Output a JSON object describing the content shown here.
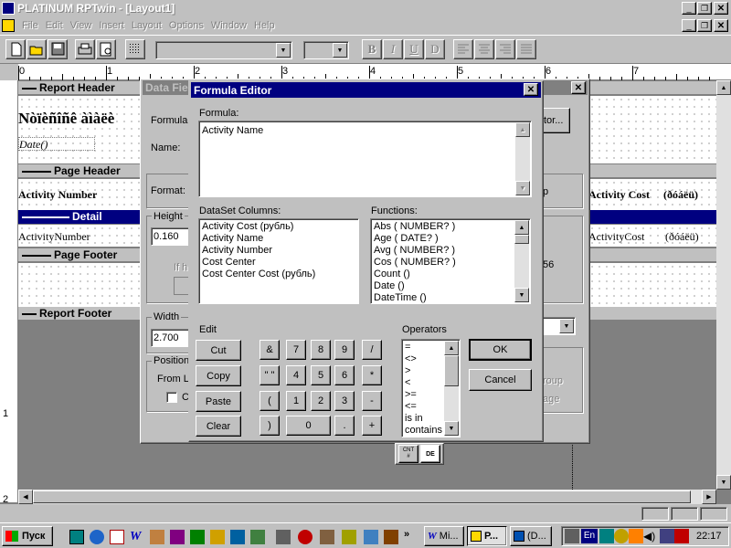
{
  "app": {
    "title": "PLATINUM RPTwin - [Layout1]",
    "menu": [
      "File",
      "Edit",
      "View",
      "Insert",
      "Layout",
      "Options",
      "Window",
      "Help"
    ]
  },
  "toolbar": {
    "format_buttons": [
      "B",
      "I",
      "U",
      "D"
    ]
  },
  "ruler": {
    "marks": [
      "0",
      "1",
      "2",
      "3",
      "4",
      "5",
      "6",
      "7"
    ]
  },
  "report": {
    "bands": {
      "report_header": "Report Header",
      "page_header": "Page Header",
      "detail": "Detail",
      "page_footer": "Page Footer",
      "report_footer": "Report Footer"
    },
    "title_text": "Nòïèñîñê àìàëè",
    "date_field": "Date()",
    "activity_number_header": "Activity Number",
    "activity_number_field": "ActivityNumber",
    "activity_cost_header": "Activity Cost",
    "activity_cost_suffix": "(ðóáëü)",
    "activity_cost_field": "ActivityCost",
    "activity_cost_field_suffix": "(ðóáëü)"
  },
  "data_field_dialog": {
    "title": "Data Fie",
    "formula_label": "Formula:",
    "name_label": "Name:",
    "format_label": "Format:",
    "height_label": "Height",
    "height_value": "0.160",
    "width_label": "Width",
    "width_value": "2.700",
    "position_label": "Position",
    "from_label": "From Le",
    "checkbox_label": "C",
    "if_label": "If h",
    "right_btn_label": "tor...",
    "right_p": "p",
    "right_56": "56",
    "right_group": "roup",
    "right_age": "age"
  },
  "formula_editor": {
    "title": "Formula Editor",
    "formula_label": "Formula:",
    "formula_value": "Activity Name",
    "dataset_label": "DataSet Columns:",
    "dataset_columns": [
      "Activity Cost    (рубль)",
      "Activity Name",
      "Activity Number",
      "Cost Center",
      "Cost Center Cost (рубль)"
    ],
    "functions_label": "Functions:",
    "functions": [
      "Abs ( NUMBER? )",
      "Age ( DATE? )",
      "Avg ( NUMBER? )",
      "Cos ( NUMBER? )",
      "Count ()",
      "Date ()",
      "DateTime ()"
    ],
    "edit_label": "Edit",
    "edit_buttons": [
      "Cut",
      "Copy",
      "Paste",
      "Clear"
    ],
    "keypad": [
      "&",
      "7",
      "8",
      "9",
      "/",
      "\" \"",
      "4",
      "5",
      "6",
      "*",
      "(",
      "1",
      "2",
      "3",
      "-",
      ")",
      "0",
      ".",
      "+"
    ],
    "operators_label": "Operators",
    "operators": [
      "=",
      "<>",
      ">",
      "<",
      ">=",
      "<=",
      "is in",
      "contains"
    ],
    "ok_label": "OK",
    "cancel_label": "Cancel"
  },
  "small_toolbar": {
    "cnt_label": "CNT",
    "cnt_sub": "#",
    "doc_label": "DE"
  },
  "taskbar": {
    "start_label": "Пуск",
    "tasks": [
      "Mi...",
      "P...",
      "(D..."
    ],
    "clock": "22:17",
    "lang": "En"
  }
}
